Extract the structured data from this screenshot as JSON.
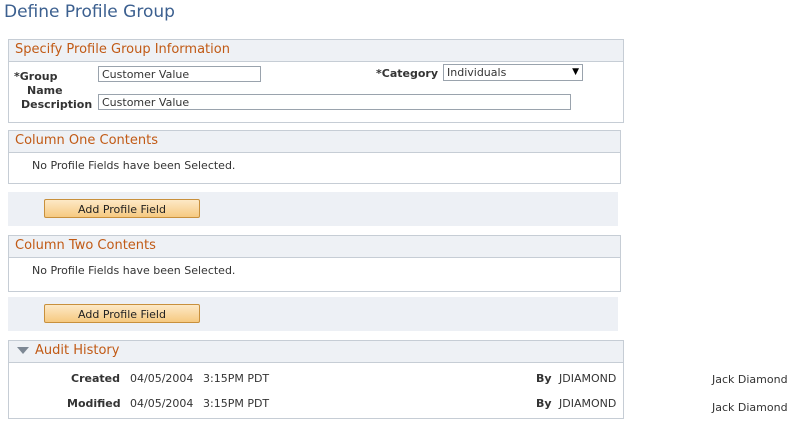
{
  "page": {
    "title": "Define Profile Group"
  },
  "profile_group": {
    "header": "Specify Profile Group Information",
    "group_name_label_line1": "*Group",
    "group_name_label_line2": "Name",
    "group_name_value": "Customer Value",
    "category_label": "*Category",
    "category_value": "Individuals",
    "description_label": "Description",
    "description_value": "Customer Value"
  },
  "column_one": {
    "header": "Column One Contents",
    "empty_message": "No Profile Fields have been Selected.",
    "add_button": "Add Profile Field"
  },
  "column_two": {
    "header": "Column Two Contents",
    "empty_message": "No Profile Fields have been Selected.",
    "add_button": "Add Profile Field"
  },
  "audit": {
    "header": "Audit History",
    "rows": [
      {
        "label": "Created",
        "date": "04/05/2004",
        "time": "3:15PM PDT",
        "by_label": "By",
        "user_id": "JDIAMOND",
        "user_name": "Jack Diamond"
      },
      {
        "label": "Modified",
        "date": "04/05/2004",
        "time": "3:15PM PDT",
        "by_label": "By",
        "user_id": "JDIAMOND",
        "user_name": "Jack Diamond"
      }
    ]
  },
  "colors": {
    "title": "#3b5f8f",
    "section_header_text": "#c15a15",
    "section_header_bg": "#eef1f5",
    "button_bg": "#f6c981"
  }
}
